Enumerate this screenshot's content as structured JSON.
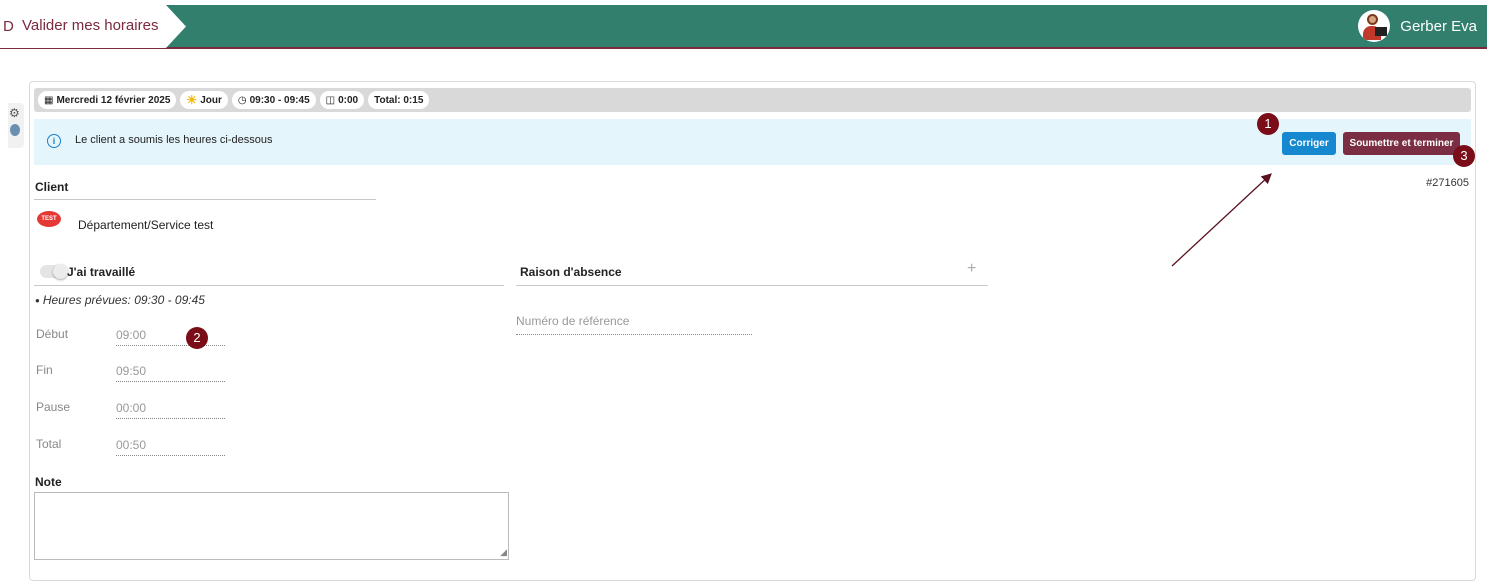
{
  "header": {
    "breadcrumb_icon": "D",
    "breadcrumb_label": "Valider mes horaires",
    "user_name": "Gerber Eva",
    "colors": {
      "bar": "#317f6c",
      "accent": "#7a2a3d"
    }
  },
  "infobar": {
    "date": "Mercredi 12 février 2025",
    "shift": "Jour",
    "hours": "09:30 - 09:45",
    "pause": "0:00",
    "total": "Total: 0:15",
    "icons": [
      "calendar-icon",
      "sun-icon",
      "clock-icon",
      "coffee-icon"
    ]
  },
  "alert": {
    "icon": "info-icon",
    "message": "Le client a soumis les heures ci-dessous",
    "corriger_label": "Corriger",
    "submit_label": "Soumettre et terminer"
  },
  "reference": "#271605",
  "client": {
    "title": "Client",
    "logo_text": "TEST",
    "name": "Département/Service test"
  },
  "worked": {
    "title": "J'ai travaillé",
    "planned": "Heures prévues: 09:30 - 09:45",
    "rows": [
      {
        "label": "Début",
        "value": "09:00"
      },
      {
        "label": "Fin",
        "value": "09:50"
      },
      {
        "label": "Pause",
        "value": "00:00"
      },
      {
        "label": "Total",
        "value": "00:50"
      }
    ]
  },
  "absence": {
    "title": "Raison d'absence",
    "add_symbol": "+",
    "reference_placeholder": "Numéro de référence"
  },
  "note": {
    "title": "Note",
    "value": ""
  },
  "annotations": {
    "badge1": "1",
    "badge2": "2",
    "badge3": "3"
  }
}
